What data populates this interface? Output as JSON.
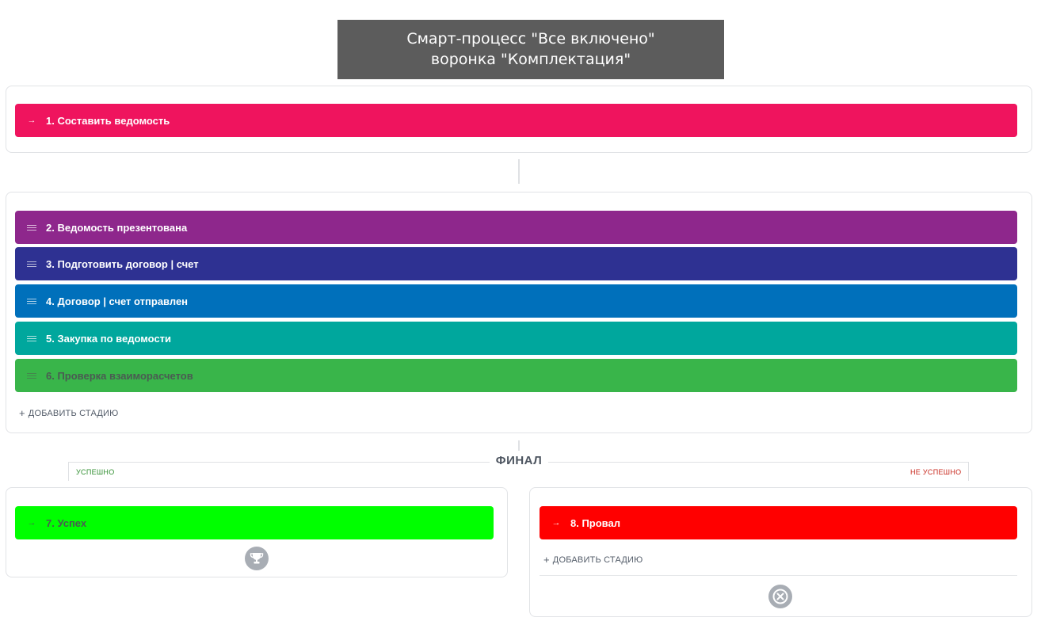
{
  "title": {
    "line1": "Смарт-процесс \"Все включено\"",
    "line2": "воронка \"Комплектация\""
  },
  "initial_stage": {
    "label": "1. Составить ведомость",
    "icon": "arrow-right-icon",
    "color": "#ef145e"
  },
  "work_stages": [
    {
      "label": "2. Ведомость презентована",
      "color": "#8e278c",
      "icon": "drag-handle-icon"
    },
    {
      "label": "3. Подготовить договор | счет",
      "color": "#2e3192",
      "icon": "drag-handle-icon"
    },
    {
      "label": "4. Договор | счет отправлен",
      "color": "#0070bb",
      "icon": "drag-handle-icon"
    },
    {
      "label": "5. Закупка по ведомости",
      "color": "#00a79d",
      "icon": "drag-handle-icon"
    },
    {
      "label": "6. Проверка взаиморасчетов",
      "color": "#39b54a",
      "icon": "drag-handle-icon"
    }
  ],
  "add_stage_label": "ДОБАВИТЬ СТАДИЮ",
  "final": {
    "label": "ФИНАЛ",
    "success_tag": "УСПЕШНО",
    "fail_tag": "НЕ УСПЕШНО",
    "success_stage": {
      "label": "7. Успех",
      "color": "#00ff00",
      "icon": "arrow-right-icon"
    },
    "fail_stage": {
      "label": "8. Провал",
      "color": "#ff0000",
      "icon": "arrow-right-icon"
    },
    "add_stage_label": "ДОБАВИТЬ СТАДИЮ",
    "success_icon": "trophy-icon",
    "fail_icon": "close-circle-icon"
  }
}
